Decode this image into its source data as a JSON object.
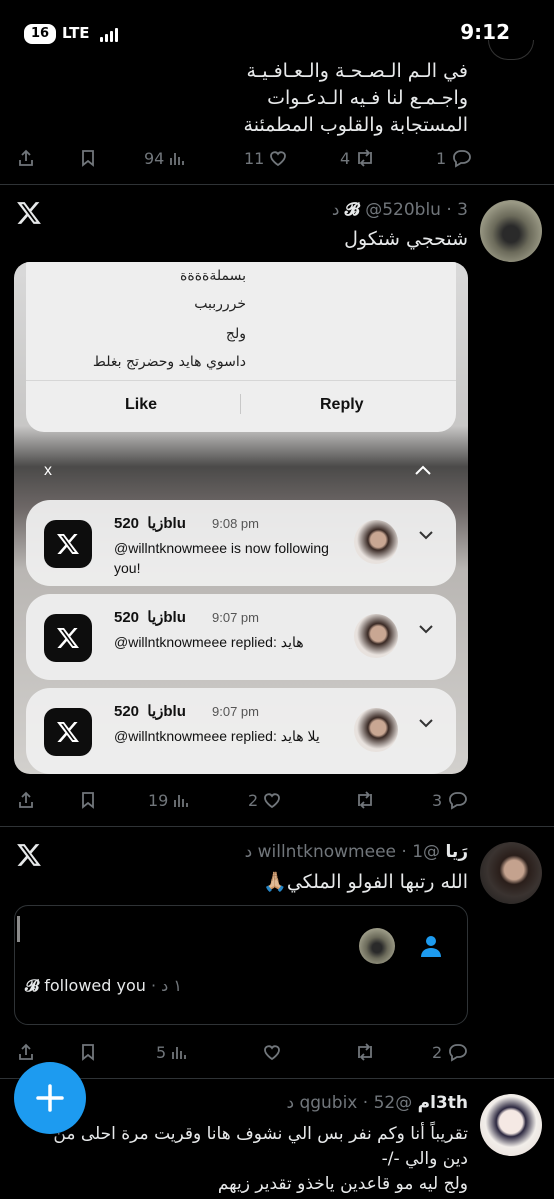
{
  "status_bar": {
    "battery": "16",
    "network": "LTE",
    "time": "9:12"
  },
  "tweet_top": {
    "text_lines": [
      "في الـم الـصـحـة والـعـافـيـة",
      "واجـمـع لنا فـيه الـدعـوات",
      "المستجابة والقلوب المطمئنة"
    ],
    "views": "94",
    "likes": "11",
    "retweets": "4",
    "replies": "1"
  },
  "tweet_two": {
    "badge": "𝓑",
    "handle": "@520blu",
    "time": "3 د",
    "text": "شتحجي شتكول",
    "screenshot": {
      "lines": [
        "بسملةةةةة",
        "خرررببب",
        "ولج",
        "داسوي هايد وحضرتج بغلط"
      ],
      "like_label": "Like",
      "reply_label": "Reply",
      "close_label": "x",
      "notifications": [
        {
          "name": "زيا",
          "handle": "520blu",
          "time": "9:08 pm",
          "body": "@willntknowmeee is now following you!"
        },
        {
          "name": "زيا",
          "handle": "520blu",
          "time": "9:07 pm",
          "body": "@willntknowmeee replied: هايد"
        },
        {
          "name": "زيا",
          "handle": "520blu",
          "time": "9:07 pm",
          "body": "@willntknowmeee replied: يلا هايد"
        }
      ]
    },
    "views": "19",
    "likes": "2",
    "retweets": "",
    "replies": "3"
  },
  "tweet_three": {
    "name": "رَيا",
    "handle": "@willntknowmeee",
    "time": "1 د",
    "text": "الله رتبها الفولو الملكي🙏🏼",
    "card": {
      "badge": "𝓑",
      "followed_text": "followed you",
      "time": "١ د"
    },
    "views": "5",
    "likes": "",
    "retweets": "",
    "replies": "2"
  },
  "tweet_four": {
    "name": "l3thم",
    "handle": "@qgubix",
    "time": "52 د",
    "text_lines": [
      "تقريباً أنا وكم نفر بس الي نشوف هانا وقريت مرة احلى من",
      "دين والي -/-",
      "ولج ليه مو قاعدين ياخذو تقدير زيهم"
    ]
  },
  "colors": {
    "accent": "#1d9bf0",
    "muted": "#71767b",
    "divider": "#2f3336"
  },
  "icons": [
    "share-icon",
    "bookmark-icon",
    "views-icon",
    "heart-icon",
    "retweet-icon",
    "reply-icon",
    "x-logo-icon",
    "chevron-down-icon",
    "chevron-up-icon",
    "person-icon",
    "plus-icon"
  ]
}
